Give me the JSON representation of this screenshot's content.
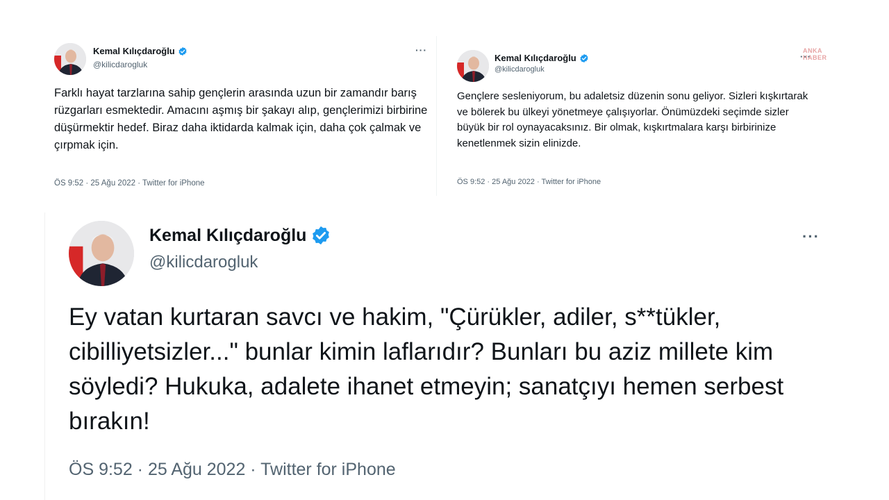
{
  "tweets": [
    {
      "name": "Kemal Kılıçdaroğlu",
      "handle": "@kilicdarogluk",
      "text": "Farklı hayat tarzlarına sahip gençlerin arasında uzun bir zamandır barış rüzgarları esmektedir. Amacını aşmış bir şakayı alıp, gençlerimizi birbirine düşürmektir hedef. Biraz daha iktidarda kalmak için, daha çok çalmak ve çırpmak için.",
      "meta": "ÖS 9:52 · 25 Ağu 2022 · Twitter for iPhone",
      "more": "···"
    },
    {
      "name": "Kemal Kılıçdaroğlu",
      "handle": "@kilicdarogluk",
      "text": "Gençlere sesleniyorum, bu adaletsiz düzenin sonu geliyor. Sizleri kışkırtarak ve bölerek bu ülkeyi yönetmeye çalışıyorlar. Önümüzdeki seçimde sizler büyük bir rol oynayacaksınız. Bir olmak, kışkırtmalara karşı birbirinize kenetlenmek sizin elinizde.",
      "meta": "ÖS 9:52 · 25 Ağu 2022 · Twitter for iPhone",
      "more": "···",
      "watermark": "ANKA HABER"
    },
    {
      "name": "Kemal Kılıçdaroğlu",
      "handle": "@kilicdarogluk",
      "text": "Ey vatan kurtaran savcı ve hakim, \"Çürükler, adiler, s**tükler, cibilliyetsizler...\" bunlar kimin laflarıdır? Bunları bu aziz millete kim söyledi? Hukuka, adalete ihanet etmeyin; sanatçıyı hemen serbest bırakın!",
      "meta": "ÖS 9:52 · 25 Ağu 2022 · Twitter for iPhone",
      "more": "···"
    }
  ],
  "colors": {
    "verified": "#1d9bf0",
    "meta": "#536471",
    "text": "#0f1419"
  },
  "icons": {
    "verified": "verified-badge-icon",
    "more": "more-options-icon"
  }
}
